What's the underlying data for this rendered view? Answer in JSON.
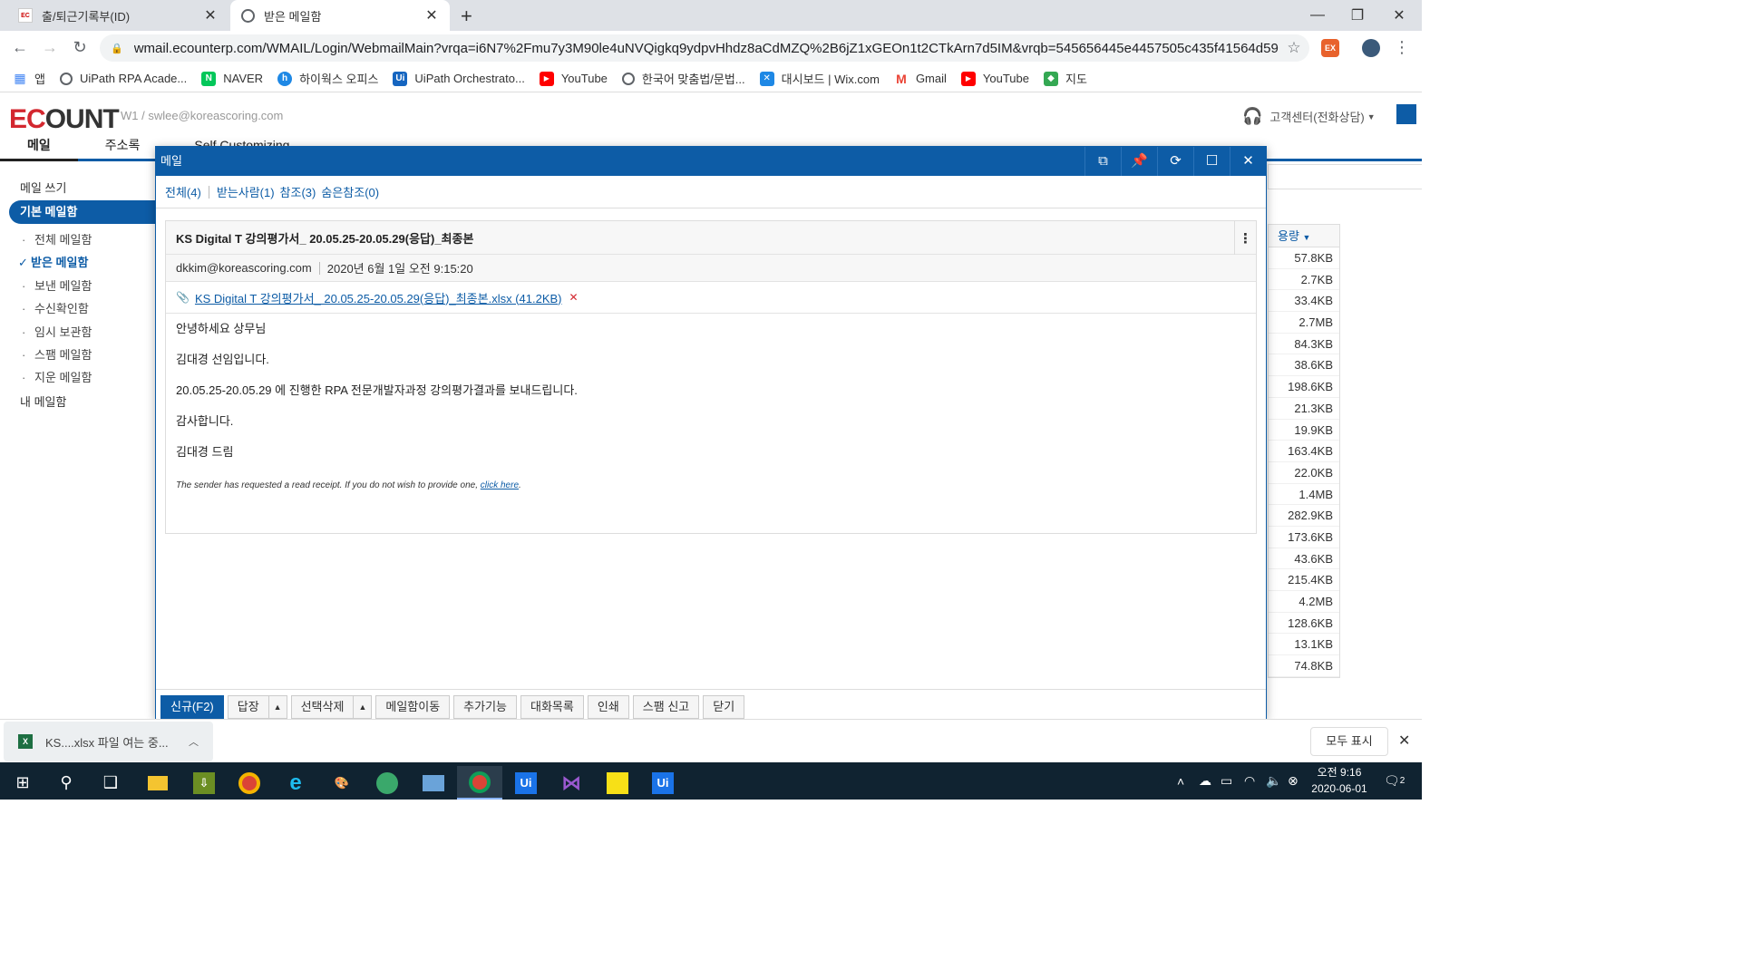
{
  "browser": {
    "tabs": [
      {
        "title": "출/퇴근기록부(ID)",
        "active": false
      },
      {
        "title": "받은 메일함",
        "active": true
      }
    ],
    "url": "wmail.ecounterp.com/WMAIL/Login/WebmailMain?vrqa=i6N7%2Fmu7y3M90le4uNVQigkq9ydpvHhdz8aCdMZQ%2B6jZ1xGEOn1t2CTkArn7d5IM&vrqb=545656445e4457505c435f41564d59435c...",
    "bookmarks": [
      {
        "label": "앱",
        "icon": "apps-grid-icon"
      },
      {
        "label": "UiPath RPA Acade...",
        "icon": "globe-icon"
      },
      {
        "label": "NAVER",
        "icon": "naver-icon"
      },
      {
        "label": "하이웍스 오피스",
        "icon": "hiworks-icon"
      },
      {
        "label": "UiPath Orchestrato...",
        "icon": "uipath-icon"
      },
      {
        "label": "YouTube",
        "icon": "youtube-icon"
      },
      {
        "label": "한국어 맞춤법/문법...",
        "icon": "globe-icon"
      },
      {
        "label": "대시보드 | Wix.com",
        "icon": "wix-icon"
      },
      {
        "label": "Gmail",
        "icon": "gmail-icon"
      },
      {
        "label": "YouTube",
        "icon": "youtube-icon"
      },
      {
        "label": "지도",
        "icon": "maps-icon"
      }
    ]
  },
  "app": {
    "account": "W1 / swlee@koreascoring.com",
    "helpdesk": "고객센터(전화상담)",
    "nav": [
      "메일",
      "주소록",
      "Self Customizing"
    ],
    "sidebar": {
      "compose": "메일 쓰기",
      "group": "기본 메일함",
      "folders": [
        "전체 메일함",
        "받은 메일함",
        "보낸 메일함",
        "수신확인함",
        "임시 보관함",
        "스팸 메일함",
        "지운 메일함"
      ],
      "my_folders": "내 메일함"
    },
    "list": {
      "size_header": "용량",
      "sizes": [
        "57.8KB",
        "2.7KB",
        "33.4KB",
        "2.7MB",
        "84.3KB",
        "38.6KB",
        "198.6KB",
        "21.3KB",
        "19.9KB",
        "163.4KB",
        "22.0KB",
        "1.4MB",
        "282.9KB",
        "173.6KB",
        "43.6KB",
        "215.4KB",
        "4.2MB",
        "128.6KB",
        "13.1KB",
        "74.8KB"
      ]
    }
  },
  "popup": {
    "title": "메일",
    "recipients": {
      "all": "전체(4)",
      "to": "받는사람(1)",
      "cc": "참조(3)",
      "bcc": "숨은참조(0)"
    },
    "mail": {
      "subject": "KS Digital T 강의평가서_ 20.05.25-20.05.29(응답)_최종본",
      "from": "dkkim@koreascoring.com",
      "date": "2020년 6월 1일 오전 9:15:20",
      "attachment": "KS Digital T 강의평가서_ 20.05.25-20.05.29(응답)_최종본.xlsx (41.2KB)",
      "body": [
        "안녕하세요 상무님",
        "김대경 선임입니다.",
        "20.05.25-20.05.29 에 진행한 RPA 전문개발자과정 강의평가결과를 보내드립니다.",
        "감사합니다.",
        "김대경 드림"
      ],
      "receipt_text": "The sender has requested a read receipt. If you do not wish to provide one, ",
      "receipt_link": "click here",
      "receipt_end": "."
    },
    "toolbar": {
      "new": "신규(F2)",
      "reply": "답장",
      "delete": "선택삭제",
      "move": "메일함이동",
      "extra": "추가기능",
      "thread": "대화목록",
      "print": "인쇄",
      "spam": "스팸 신고",
      "close": "닫기"
    }
  },
  "downloads": {
    "item": "KS....xlsx 파일 여는 중...",
    "show_all": "모두 표시"
  },
  "taskbar": {
    "time": "오전 9:16",
    "date": "2020-06-01",
    "notifications": "2"
  },
  "colors": {
    "accent": "#0d5ca6",
    "brand_red": "#d3272f"
  }
}
